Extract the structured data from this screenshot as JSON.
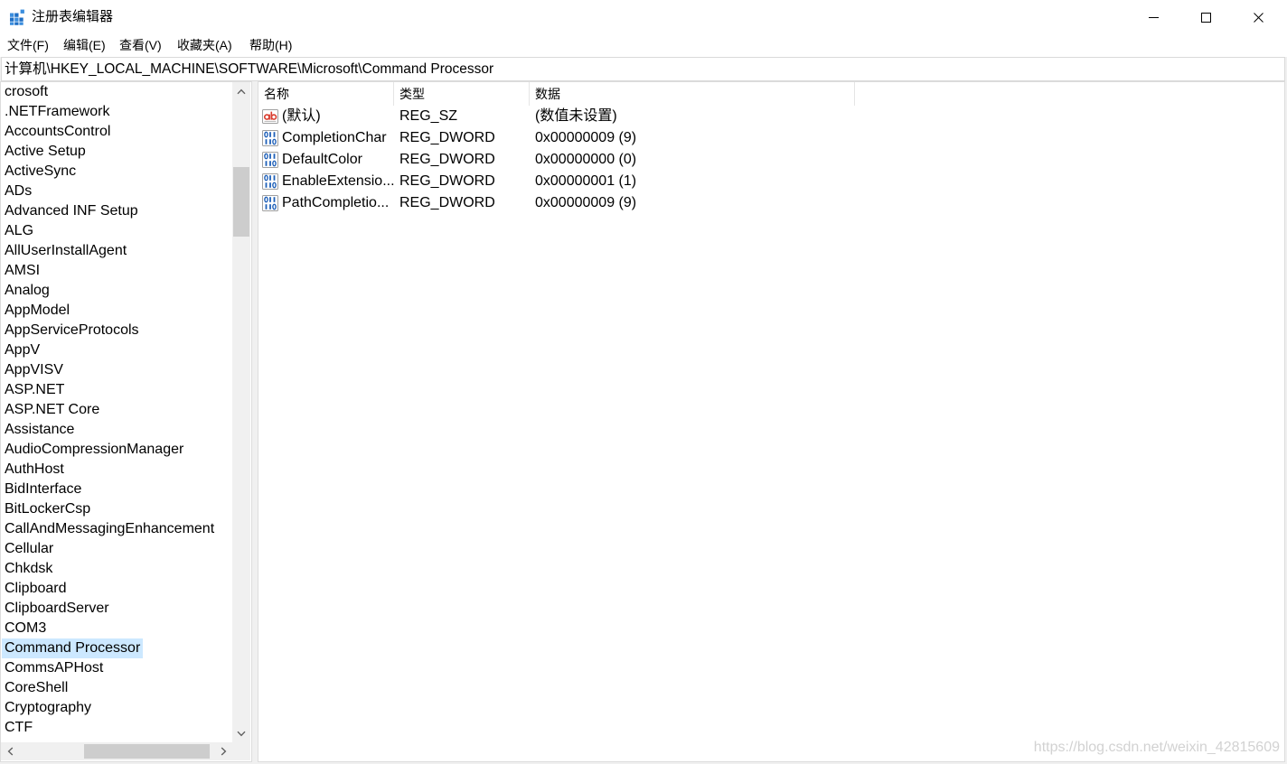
{
  "window": {
    "title": "注册表编辑器",
    "app_icon": "registry-editor-icon",
    "control_icons": [
      "minimize-icon",
      "maximize-icon",
      "close-icon"
    ]
  },
  "menu": [
    {
      "label": "文件(F)"
    },
    {
      "label": "编辑(E)"
    },
    {
      "label": "查看(V)"
    },
    {
      "label": "收藏夹(A)"
    },
    {
      "label": "帮助(H)"
    }
  ],
  "address_bar": {
    "value": "计算机\\HKEY_LOCAL_MACHINE\\SOFTWARE\\Microsoft\\Command Processor"
  },
  "tree": {
    "items": [
      {
        "label": "crosoft"
      },
      {
        "label": ".NETFramework"
      },
      {
        "label": "AccountsControl"
      },
      {
        "label": "Active Setup"
      },
      {
        "label": "ActiveSync"
      },
      {
        "label": "ADs"
      },
      {
        "label": "Advanced INF Setup"
      },
      {
        "label": "ALG"
      },
      {
        "label": "AllUserInstallAgent"
      },
      {
        "label": "AMSI"
      },
      {
        "label": "Analog"
      },
      {
        "label": "AppModel"
      },
      {
        "label": "AppServiceProtocols"
      },
      {
        "label": "AppV"
      },
      {
        "label": "AppVISV"
      },
      {
        "label": "ASP.NET"
      },
      {
        "label": "ASP.NET Core"
      },
      {
        "label": "Assistance"
      },
      {
        "label": "AudioCompressionManager"
      },
      {
        "label": "AuthHost"
      },
      {
        "label": "BidInterface"
      },
      {
        "label": "BitLockerCsp"
      },
      {
        "label": "CallAndMessagingEnhancement"
      },
      {
        "label": "Cellular"
      },
      {
        "label": "Chkdsk"
      },
      {
        "label": "Clipboard"
      },
      {
        "label": "ClipboardServer"
      },
      {
        "label": "COM3"
      },
      {
        "label": "Command Processor",
        "selected": true
      },
      {
        "label": "CommsAPHost"
      },
      {
        "label": "CoreShell"
      },
      {
        "label": "Cryptography"
      },
      {
        "label": "CTF"
      }
    ]
  },
  "values_list": {
    "columns": [
      "名称",
      "类型",
      "数据"
    ],
    "rows": [
      {
        "icon": "string-value-icon",
        "name": "(默认)",
        "type": "REG_SZ",
        "data": "(数值未设置)"
      },
      {
        "icon": "binary-value-icon",
        "name": "CompletionChar",
        "type": "REG_DWORD",
        "data": "0x00000009 (9)"
      },
      {
        "icon": "binary-value-icon",
        "name": "DefaultColor",
        "type": "REG_DWORD",
        "data": "0x00000000 (0)"
      },
      {
        "icon": "binary-value-icon",
        "name": "EnableExtensio...",
        "type": "REG_DWORD",
        "data": "0x00000001 (1)"
      },
      {
        "icon": "binary-value-icon",
        "name": "PathCompletio...",
        "type": "REG_DWORD",
        "data": "0x00000009 (9)"
      }
    ]
  },
  "watermark": {
    "text": "https://blog.csdn.net/weixin_42815609"
  },
  "colors": {
    "selection": "#cce8ff",
    "string_icon": "#d83b2d",
    "binary_icon": "#1d5fb8",
    "watermark": "#d2d2d2",
    "scroll_thumb": "#cdcdcd"
  },
  "icons": {
    "scrollbar": [
      "chevron-up-icon",
      "chevron-down-icon",
      "chevron-left-icon",
      "chevron-right-icon"
    ]
  }
}
